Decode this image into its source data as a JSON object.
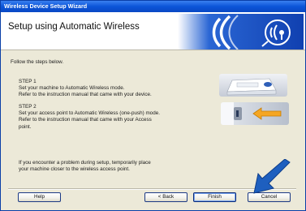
{
  "window": {
    "title": "Wireless Device Setup Wizard"
  },
  "header": {
    "title": "Setup using Automatic Wireless"
  },
  "instructions": "Follow the steps below.",
  "steps": [
    {
      "heading": "STEP 1",
      "lines": [
        "Set your machine to Automatic Wireless mode.",
        "Refer to the instruction manual that came with your device."
      ]
    },
    {
      "heading": "STEP 2",
      "lines": [
        "Set your access point to Automatic Wireless (one-push) mode.",
        "Refer to the instruction manual that came with your Access",
        "point."
      ]
    }
  ],
  "note": [
    "If you encounter a problem during setup, temporarily place",
    "your machine closer to the wireless access point."
  ],
  "buttons": {
    "help": "Help",
    "back": "< Back",
    "finish": "Finish",
    "cancel": "Cancel"
  },
  "icons": {
    "banner": "wireless-waves-icon",
    "step1": "printer-illustration",
    "step2": "access-point-button-illustration",
    "pointer": "blue-pointer-arrow"
  },
  "colors": {
    "titlebar": "#0b55d8",
    "banner": "#1a50c0",
    "dialog": "#ece9d8",
    "pointer_arrow": "#1e5fbf",
    "step2_arrow": "#f5a623"
  }
}
